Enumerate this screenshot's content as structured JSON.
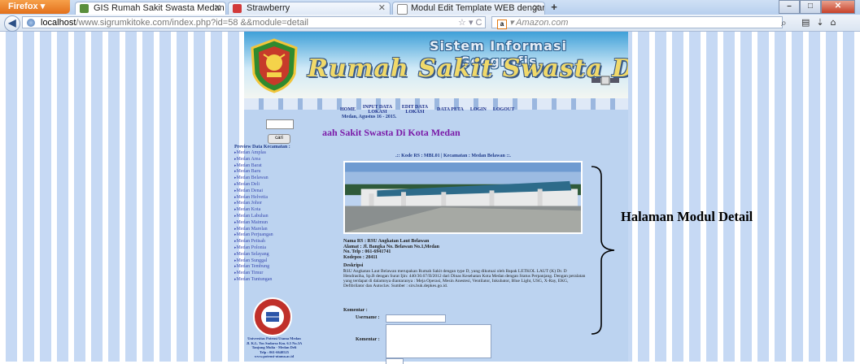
{
  "browser": {
    "menu_button": "Firefox",
    "tabs": [
      {
        "title": "GIS Rumah Sakit Swasta Medan",
        "active": true
      },
      {
        "title": "Strawberry",
        "active": false
      },
      {
        "title": "Modul Edit Template WEB dengan P...",
        "active": false
      }
    ],
    "new_tab": "+",
    "url_host": "localhost",
    "url_path": "/www.sigrumkitoke.com/index.php?id=58 &&module=detail",
    "search_placeholder": "Amazon.com",
    "window_controls": [
      "–",
      "□",
      "✕"
    ]
  },
  "site": {
    "banner_top": "Sistem Informasi Geografis",
    "banner_title": "Rumah Sakit Swasta Di Kota Medan",
    "menu": [
      "HOME",
      "INPUT DATA LOKASI",
      "EDIT DATA LOKASI",
      "DATA PETA",
      "LOGIN",
      "LOGOUT"
    ],
    "date": "Medan, Agustus 16 - 2015.",
    "heading": "aah Sakit Swasta Di Kota Medan",
    "search_button": "cari",
    "preview_title": "Preview Data Kecamatan :",
    "districts": [
      "Medan Amplas",
      "Medan Area",
      "Medan Barat",
      "Medan Baru",
      "Medan Belawan",
      "Medan Deli",
      "Medan Denai",
      "Medan Helvetia",
      "Medan Johor",
      "Medan Kota",
      "Medan Labuhan",
      "Medan Maimun",
      "Medan Marelan",
      "Medan Perjuangan",
      "Medan Petisah",
      "Medan Polonia",
      "Medan Selayang",
      "Medan Sunggal",
      "Medan Tembung",
      "Medan Timur",
      "Medan Tuntungan"
    ],
    "university": {
      "lines": [
        "Universitas Potensi Utama Medan",
        "Jl. K.L. Yos Sudarso Km. 6.5 No.3A",
        "Tanjung Mulia - Medan Deli",
        "Telp : 061-6640525",
        "www.potensi-utama.ac.id"
      ]
    },
    "detail": {
      "kode_line": ".:: Kode RS : MBL01 | Kecamatan : Medan Belawan ::.",
      "nama": "Nama RS : RSU Angkatan Laut Belawan",
      "alamat": "Alamat : Jl. Bangka No. Belawan No.1,Medan",
      "telp": "No. Telp : 061-6941741",
      "kodepos": "Kodepos : 20411",
      "desc_label": "Deskripsi :",
      "desc_text": "RSU Angkatan Laut Belawan merupakan Rumah Sakit dengan type D, yang dikutuai oleh Bapak LETKOL LAUT (K) Dr. D Hendrasiha, Sp.B dengan Surat Ijin: 440/30.67/II/2012 dari Dinas Kesehatan Kota Medan dengan Status Perpanjang. Dengan peralatan yang terdapat di dalamnya diantaranya : Meja Operasi, Mesin Anestesi, Ventilator, Inkubator, Blue Light, USG, X-Ray, EKG, Defibrilator dan Autoclav. Sumber : sirs.buk.depkes.go.id."
    },
    "form": {
      "title": "Komentar :",
      "username_label": "Username :",
      "komentar_label": "Komentar :"
    }
  },
  "annotation": "Halaman Modul Detail",
  "colors": {
    "accent": "#7a1aa8",
    "link": "#3a4bb0",
    "page_bg": "#bcd3f0",
    "stripe": "#c6d9f4"
  }
}
